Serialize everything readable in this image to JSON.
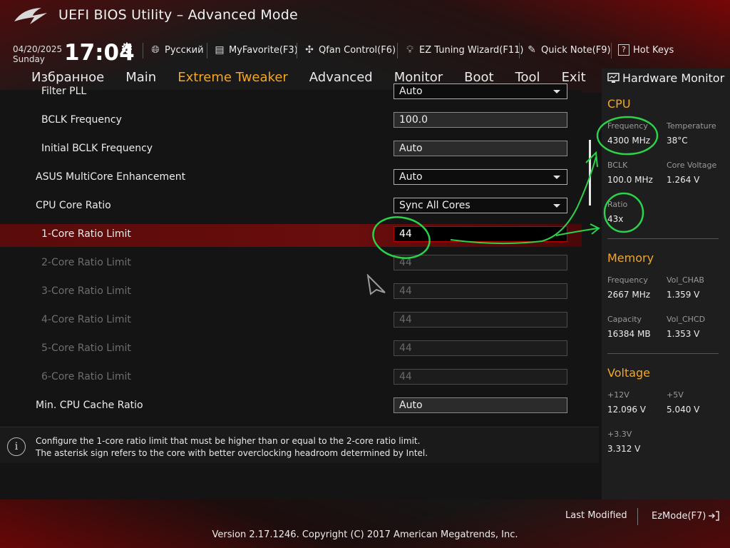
{
  "header": {
    "title": "UEFI BIOS Utility – Advanced Mode",
    "date": "04/20/2025",
    "day": "Sunday",
    "time": "17:04",
    "toolbar": {
      "language": "Русский",
      "myfavorite": "MyFavorite(F3)",
      "qfan": "Qfan Control(F6)",
      "ez_tuning": "EZ Tuning Wizard(F11)",
      "quick_note": "Quick Note(F9)",
      "hot_keys": "Hot Keys"
    }
  },
  "nav": {
    "items": [
      "Избранное",
      "Main",
      "Extreme Tweaker",
      "Advanced",
      "Monitor",
      "Boot",
      "Tool",
      "Exit"
    ],
    "active": "Extreme Tweaker"
  },
  "settings": [
    {
      "label": "Filter PLL",
      "value": "Auto",
      "type": "dropdown",
      "state": "normal"
    },
    {
      "label": "BCLK Frequency",
      "value": "100.0",
      "type": "text",
      "state": "normal"
    },
    {
      "label": "Initial BCLK Frequency",
      "value": "Auto",
      "type": "text",
      "state": "normal"
    },
    {
      "label": "ASUS MultiCore Enhancement",
      "value": "Auto",
      "type": "dropdown",
      "state": "normal"
    },
    {
      "label": "CPU Core Ratio",
      "value": "Sync All Cores",
      "type": "dropdown",
      "state": "normal"
    },
    {
      "label": "1-Core Ratio Limit",
      "value": "44",
      "type": "text",
      "state": "selected"
    },
    {
      "label": "2-Core Ratio Limit",
      "value": "44",
      "type": "text",
      "state": "disabled"
    },
    {
      "label": "3-Core Ratio Limit",
      "value": "44",
      "type": "text",
      "state": "disabled"
    },
    {
      "label": "4-Core Ratio Limit",
      "value": "44",
      "type": "text",
      "state": "disabled"
    },
    {
      "label": "5-Core Ratio Limit",
      "value": "44",
      "type": "text",
      "state": "disabled"
    },
    {
      "label": "6-Core Ratio Limit",
      "value": "44",
      "type": "text",
      "state": "disabled"
    },
    {
      "label": "Min. CPU Cache Ratio",
      "value": "Auto",
      "type": "text",
      "state": "normal"
    }
  ],
  "help": {
    "line1": "Configure the 1-core ratio limit that must be higher than or equal to the 2-core ratio limit.",
    "line2": "The asterisk sign refers to the core with better overclocking headroom determined by Intel."
  },
  "hw_monitor": {
    "title": "Hardware Monitor",
    "cpu": {
      "heading": "CPU",
      "frequency_label": "Frequency",
      "frequency": "4300 MHz",
      "temperature_label": "Temperature",
      "temperature": "38°C",
      "bclk_label": "BCLK",
      "bclk": "100.0 MHz",
      "core_voltage_label": "Core Voltage",
      "core_voltage": "1.264 V",
      "ratio_label": "Ratio",
      "ratio": "43x"
    },
    "memory": {
      "heading": "Memory",
      "frequency_label": "Frequency",
      "frequency": "2667 MHz",
      "vol_chab_label": "Vol_CHAB",
      "vol_chab": "1.359 V",
      "capacity_label": "Capacity",
      "capacity": "16384 MB",
      "vol_chcd_label": "Vol_CHCD",
      "vol_chcd": "1.353 V"
    },
    "voltage": {
      "heading": "Voltage",
      "v12_label": "+12V",
      "v12": "12.096 V",
      "v5_label": "+5V",
      "v5": "5.040 V",
      "v33_label": "+3.3V",
      "v33": "3.312 V"
    }
  },
  "footer": {
    "last_modified": "Last Modified",
    "ezmode": "EzMode(F7)",
    "copyright": "Version 2.17.1246. Copyright (C) 2017 American Megatrends, Inc."
  },
  "colors": {
    "accent": "#f5a623",
    "selected_row": "#6a0d0d",
    "annotation": "#2bd24a"
  }
}
